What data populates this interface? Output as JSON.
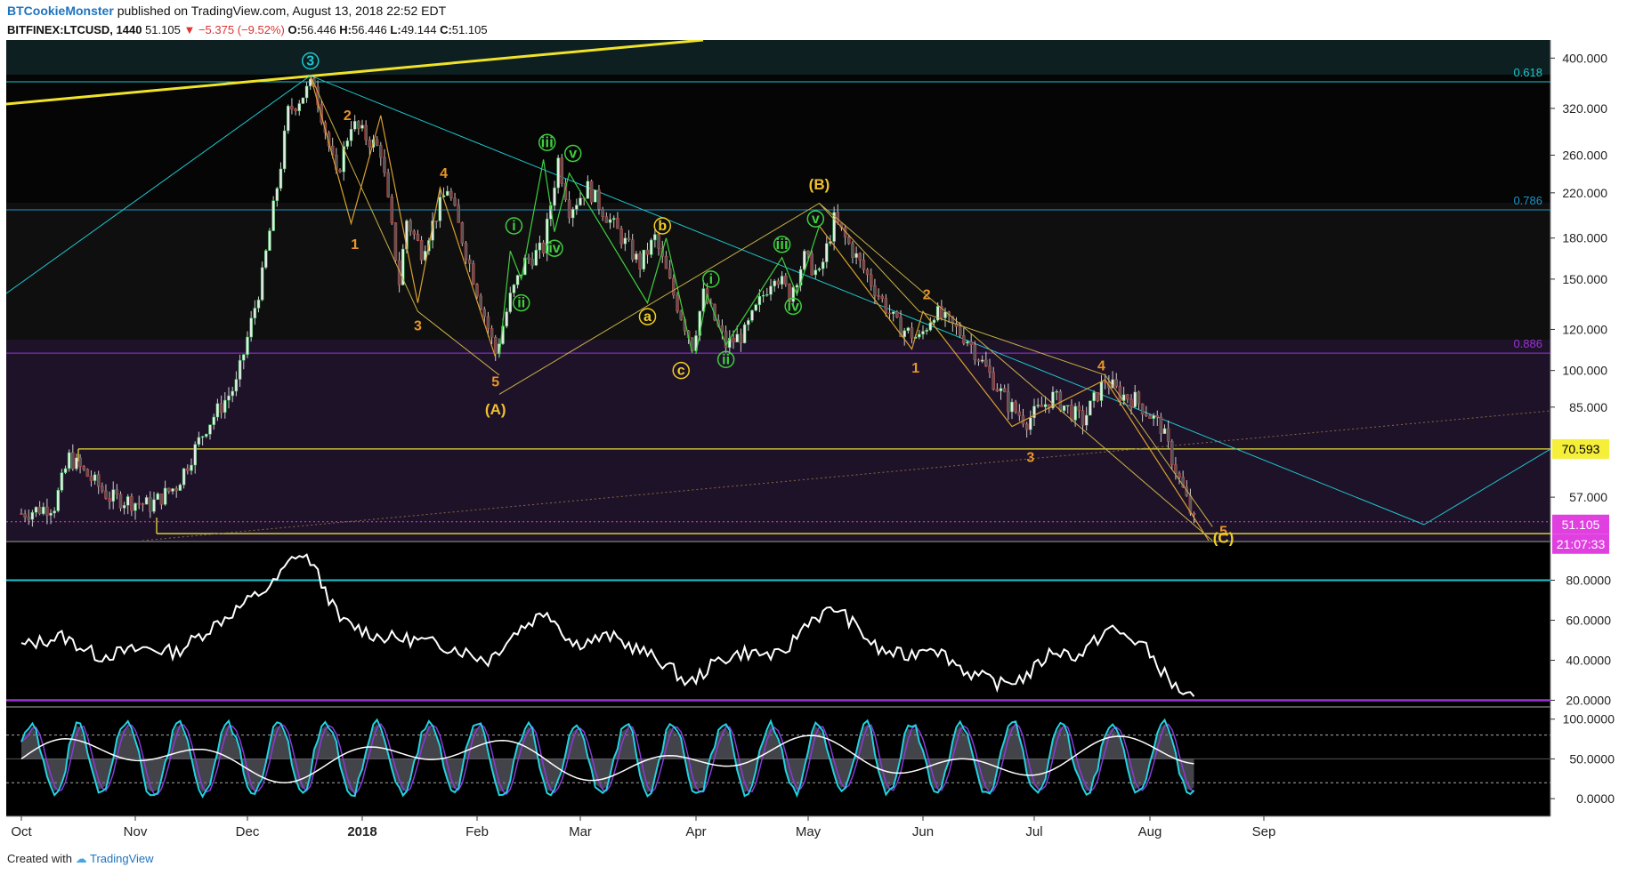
{
  "header": {
    "author": "BTCookieMonster",
    "published": "published on TradingView.com, August 13, 2018 22:52 EDT",
    "symbol": "BITFINEX:LTCUSD, 1440",
    "last": "51.105",
    "change": "−5.375 (−9.52%)",
    "o_label": "O:",
    "o_val": "56.446",
    "h_label": "H:",
    "h_val": "56.446",
    "l_label": "L:",
    "l_val": "49.144",
    "c_label": "C:",
    "c_val": "51.105"
  },
  "footer": {
    "created": "Created with",
    "brand": "TradingView"
  },
  "chart_data": [
    {
      "type": "line",
      "name": "price",
      "x_ticks": [
        "Oct",
        "Nov",
        "Dec",
        "2018",
        "Feb",
        "Mar",
        "Apr",
        "May",
        "Jun",
        "Jul",
        "Aug",
        "Sep"
      ],
      "y_ticks": [
        "400.000",
        "320.000",
        "260.000",
        "220.000",
        "180.000",
        "150.000",
        "120.000",
        "100.000",
        "85.000",
        "57.000"
      ],
      "ylim": [
        47,
        430
      ],
      "log_scale": true,
      "series_dates": [
        "2017-10-01",
        "2017-10-10",
        "2017-10-14",
        "2017-10-25",
        "2017-11-05",
        "2017-11-12",
        "2017-11-20",
        "2017-11-28",
        "2017-12-05",
        "2017-12-10",
        "2017-12-12",
        "2017-12-19",
        "2017-12-25",
        "2017-12-29",
        "2018-01-06",
        "2018-01-11",
        "2018-01-13",
        "2018-01-17",
        "2018-01-24",
        "2018-02-06",
        "2018-02-10",
        "2018-02-14",
        "2018-02-19",
        "2018-02-23",
        "2018-02-26",
        "2018-03-03",
        "2018-03-17",
        "2018-03-21",
        "2018-03-26",
        "2018-03-31",
        "2018-04-03",
        "2018-04-09",
        "2018-04-14",
        "2018-04-22",
        "2018-04-26",
        "2018-04-30",
        "2018-05-04",
        "2018-05-08",
        "2018-05-13",
        "2018-05-25",
        "2018-05-31",
        "2018-06-04",
        "2018-06-13",
        "2018-06-24",
        "2018-06-29",
        "2018-07-06",
        "2018-07-14",
        "2018-07-20",
        "2018-07-24",
        "2018-07-28",
        "2018-08-04",
        "2018-08-13"
      ],
      "series": [
        {
          "values": [
            53,
            55,
            68,
            57,
            55,
            60,
            78,
            94,
            152,
            250,
            315,
            360,
            235,
            300,
            265,
            148,
            195,
            170,
            225,
            108,
            138,
            162,
            172,
            255,
            205,
            225,
            160,
            180,
            140,
            112,
            140,
            112,
            118,
            155,
            140,
            165,
            152,
            195,
            170,
            122,
            115,
            130,
            115,
            86,
            80,
            89,
            80,
            96,
            90,
            88,
            78,
            51.105
          ]
        }
      ],
      "price_labels": [
        "70.593",
        "51.105",
        "21:07:33"
      ],
      "fib_labels": [
        "0.618",
        "0.786",
        "0.886"
      ],
      "wave_labels": [
        "3",
        "2",
        "1",
        "3",
        "4",
        "5",
        "(A)",
        "i",
        "ii",
        "iii",
        "iv",
        "v",
        "a",
        "b",
        "c",
        "i",
        "ii",
        "iii",
        "iv",
        "v",
        "(B)",
        "2",
        "1",
        "3",
        "4",
        "5",
        "(C)"
      ]
    },
    {
      "type": "line",
      "name": "rsi",
      "y_ticks": [
        "80.0000",
        "60.0000",
        "40.0000",
        "20.0000"
      ],
      "ylim": [
        18,
        98
      ],
      "series_dates": [
        "2017-10-01",
        "2017-10-12",
        "2017-10-22",
        "2017-11-04",
        "2017-11-12",
        "2017-11-24",
        "2017-12-03",
        "2017-12-08",
        "2017-12-14",
        "2017-12-18",
        "2017-12-26",
        "2018-01-05",
        "2018-01-16",
        "2018-01-26",
        "2018-02-04",
        "2018-02-12",
        "2018-02-20",
        "2018-02-27",
        "2018-03-09",
        "2018-03-18",
        "2018-03-24",
        "2018-03-30",
        "2018-04-07",
        "2018-04-14",
        "2018-04-24",
        "2018-05-01",
        "2018-05-09",
        "2018-05-20",
        "2018-05-28",
        "2018-06-03",
        "2018-06-13",
        "2018-06-22",
        "2018-06-29",
        "2018-07-06",
        "2018-07-13",
        "2018-07-21",
        "2018-07-30",
        "2018-08-07",
        "2018-08-13"
      ],
      "series": [
        {
          "values": [
            47,
            52,
            42,
            46,
            44,
            60,
            72,
            78,
            93,
            90,
            60,
            52,
            50,
            46,
            40,
            55,
            65,
            48,
            52,
            44,
            38,
            28,
            40,
            44,
            42,
            60,
            66,
            45,
            42,
            48,
            34,
            28,
            32,
            45,
            42,
            56,
            48,
            28,
            20
          ]
        }
      ]
    },
    {
      "type": "line",
      "name": "stoch_rsi",
      "y_ticks": [
        "100.0000",
        "50.0000",
        "0.0000"
      ],
      "ylim": [
        -20,
        112
      ]
    }
  ]
}
